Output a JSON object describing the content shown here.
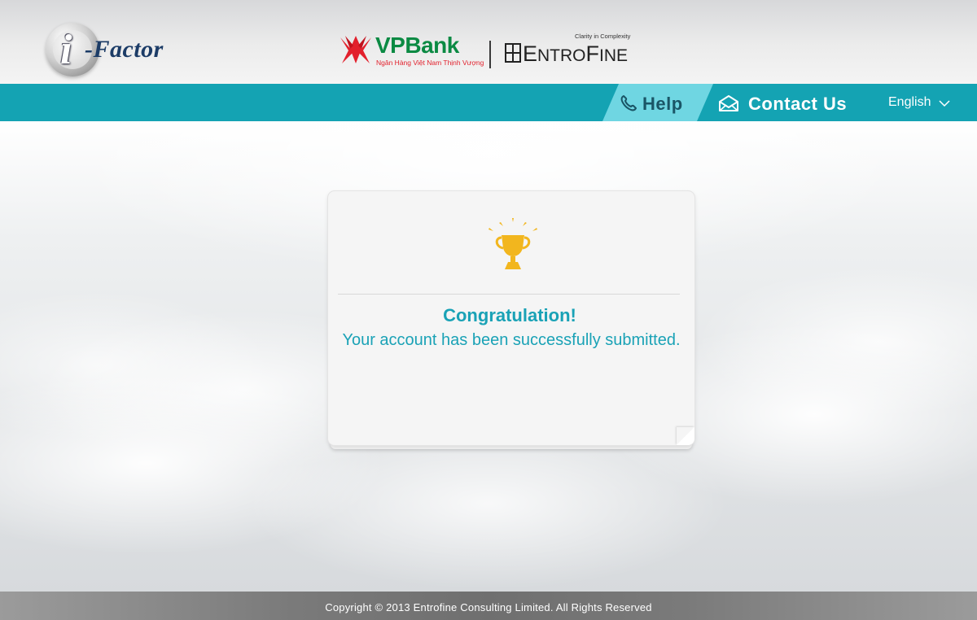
{
  "header": {
    "ifactor_logo": {
      "letter": "i",
      "text": "-Factor"
    },
    "vpbank_logo": {
      "name": "VPBank",
      "tagline": "Ngân Hàng Việt Nam Thịnh Vượng"
    },
    "entrofine_logo": {
      "tagline": "Clarity in Complexity",
      "name_big_e": "E",
      "name_ntro": "NTRO",
      "name_big_f": "F",
      "name_ine": "INE"
    }
  },
  "nav": {
    "help_label": "Help",
    "contact_label": "Contact Us",
    "language_label": "English"
  },
  "card": {
    "title": "Congratulation!",
    "message": "Your account has been successfully submitted."
  },
  "footer": {
    "copyright": "Copyright © 2013 Entrofine Consulting Limited. All Rights Reserved"
  },
  "colors": {
    "nav_bar": "#14a3b3",
    "help_tab": "#6fd6e2",
    "accent_text": "#1aa2b6",
    "trophy": "#f2b61e",
    "vpbank_green": "#0b8a43",
    "vpbank_red": "#e2202c"
  },
  "icons": {
    "help": "phone-icon",
    "contact": "mail-icon",
    "language": "chevron-down-icon",
    "success": "trophy-icon"
  }
}
